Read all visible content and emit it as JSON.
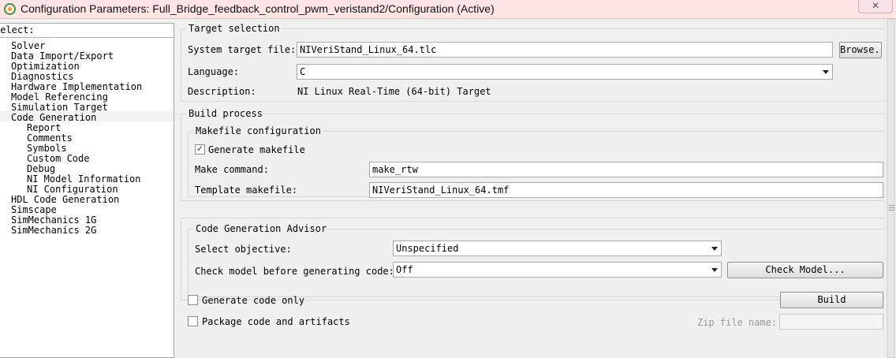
{
  "window": {
    "title": "Configuration Parameters: Full_Bridge_feedback_control_pwm_veristand2/Configuration (Active)",
    "close_label": "✕"
  },
  "tree": {
    "header": "Select:",
    "items": [
      {
        "label": "Solver",
        "level": 0
      },
      {
        "label": "Data Import/Export",
        "level": 0
      },
      {
        "label": "Optimization",
        "level": 0
      },
      {
        "label": "Diagnostics",
        "level": 0
      },
      {
        "label": "Hardware Implementation",
        "level": 0
      },
      {
        "label": "Model Referencing",
        "level": 0
      },
      {
        "label": "Simulation Target",
        "level": 0
      },
      {
        "label": "Code Generation",
        "level": 0,
        "selected": true
      },
      {
        "label": "Report",
        "level": 1
      },
      {
        "label": "Comments",
        "level": 1
      },
      {
        "label": "Symbols",
        "level": 1
      },
      {
        "label": "Custom Code",
        "level": 1
      },
      {
        "label": "Debug",
        "level": 1
      },
      {
        "label": "NI Model Information",
        "level": 1
      },
      {
        "label": "NI Configuration",
        "level": 1
      },
      {
        "label": "HDL Code Generation",
        "level": 0
      },
      {
        "label": "Simscape",
        "level": 0
      },
      {
        "label": "SimMechanics 1G",
        "level": 0
      },
      {
        "label": "SimMechanics 2G",
        "level": 0
      }
    ]
  },
  "target_selection": {
    "legend": "Target selection",
    "system_target_label": "System target file:",
    "system_target_value": "NIVeriStand_Linux_64.tlc",
    "browse_label": "Browse...",
    "language_label": "Language:",
    "language_value": "C",
    "description_label": "Description:",
    "description_value": "NI Linux Real-Time (64-bit) Target"
  },
  "build_process": {
    "legend": "Build process",
    "makefile_legend": "Makefile configuration",
    "generate_makefile_label": "Generate makefile",
    "generate_makefile_checked": true,
    "make_command_label": "Make command:",
    "make_command_value": "make_rtw",
    "template_makefile_label": "Template makefile:",
    "template_makefile_value": "NIVeriStand_Linux_64.tmf"
  },
  "advisor": {
    "legend": "Code Generation Advisor",
    "objective_label": "Select objective:",
    "objective_value": "Unspecified",
    "check_model_label": "Check model before generating code:",
    "check_model_value": "Off",
    "check_model_button": "Check Model..."
  },
  "bottom": {
    "generate_code_only_label": "Generate code only",
    "generate_code_only_checked": false,
    "build_button": "Build",
    "package_label": "Package code and artifacts",
    "package_checked": false,
    "zip_label": "Zip file name:",
    "zip_value": ""
  }
}
